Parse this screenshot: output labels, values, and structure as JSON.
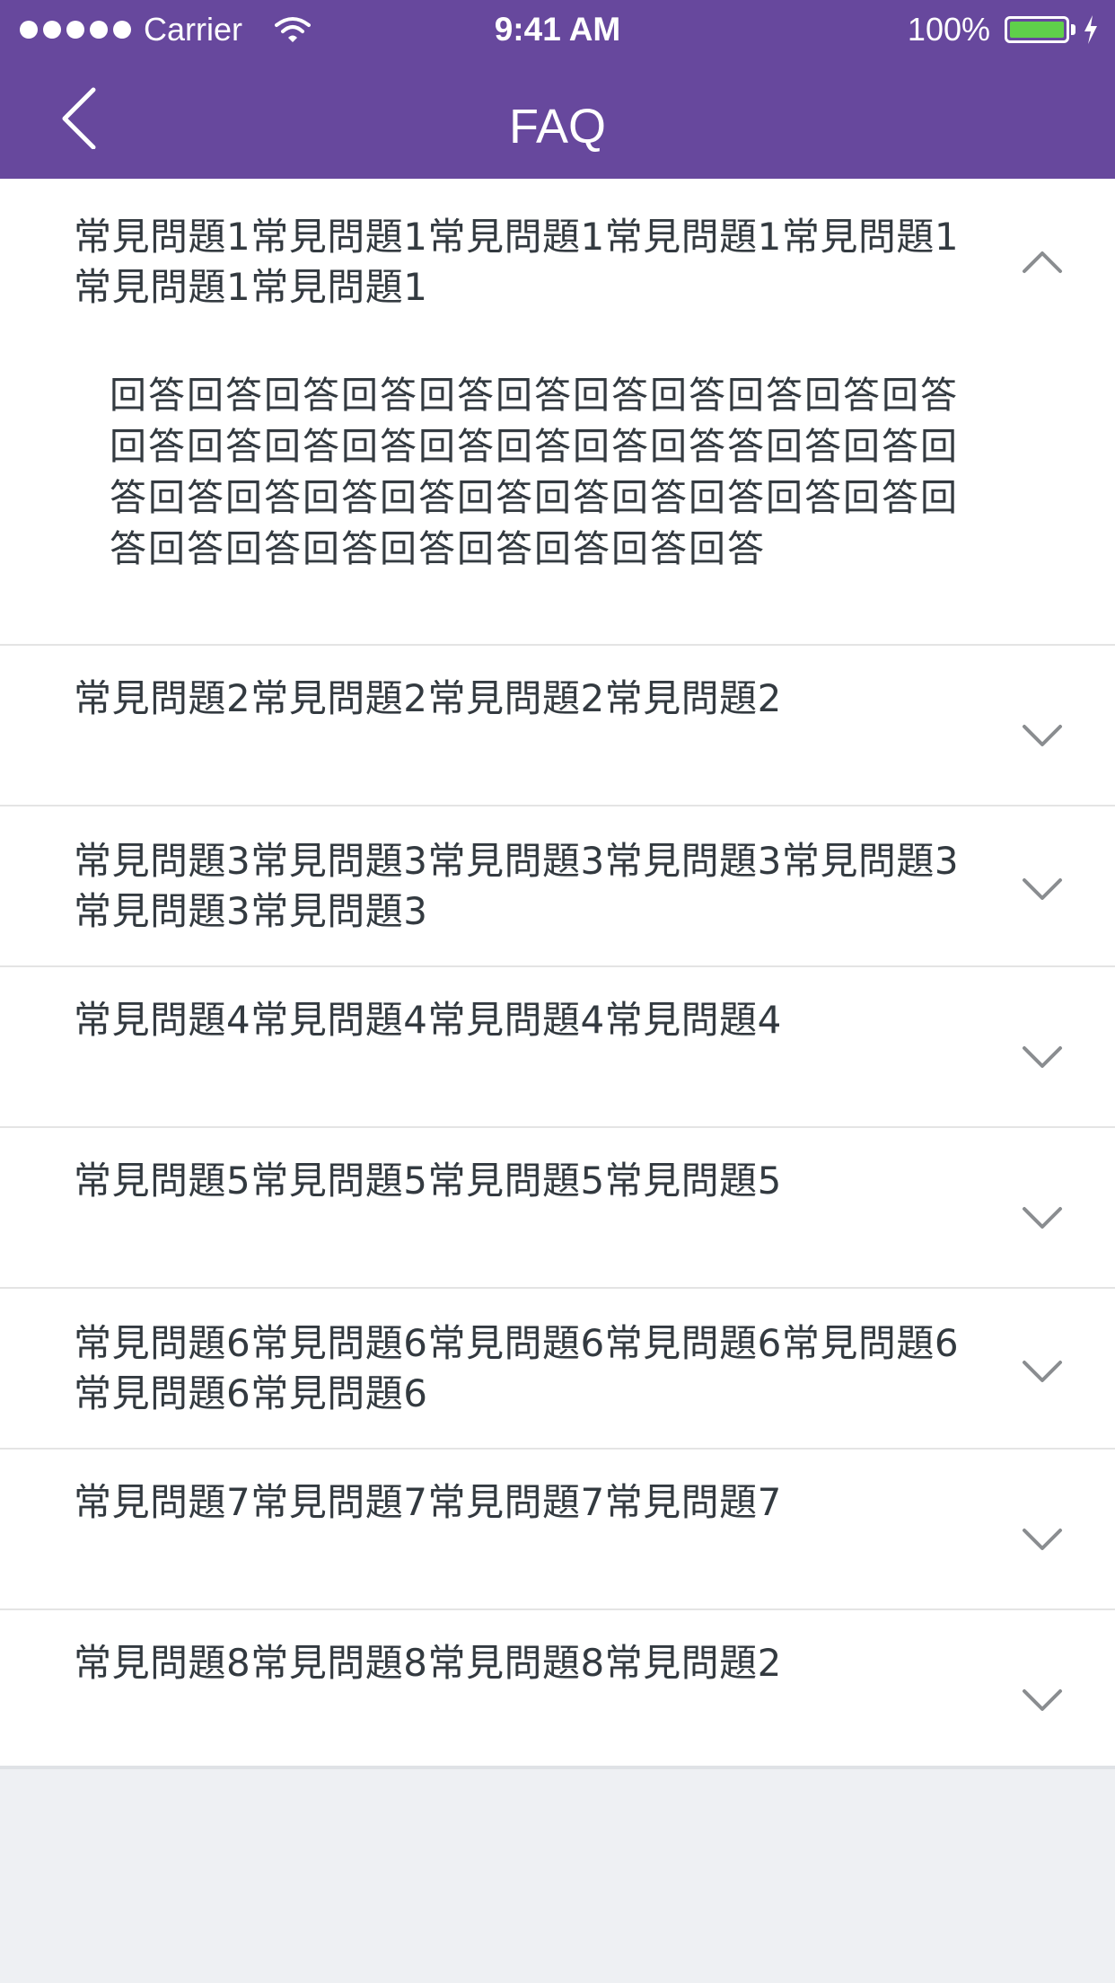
{
  "status_bar": {
    "carrier": "Carrier",
    "time": "9:41 AM",
    "battery": "100%",
    "battery_level": 1.0,
    "signal_dots": 5
  },
  "nav": {
    "title": "FAQ",
    "back_icon": "chevron-left-icon"
  },
  "faq": [
    {
      "question": "常見問題1常見問題1常見問題1常見問題1常見問題1常見問題1常見問題1",
      "answer": "回答回答回答回答回答回答回答回答回答回答回答回答回答回答回答回答回答回答回答答回答回答回答回答回答回答回答回答回答回答回答回答回答回答回答回答回答回答回答回答回答回答",
      "expanded": true
    },
    {
      "question": "常見問題2常見問題2常見問題2常見問題2",
      "expanded": false
    },
    {
      "question": "常見問題3常見問題3常見問題3常見問題3常見問題3常見問題3常見問題3",
      "expanded": false
    },
    {
      "question": "常見問題4常見問題4常見問題4常見問題4",
      "expanded": false
    },
    {
      "question": "常見問題5常見問題5常見問題5常見問題5",
      "expanded": false
    },
    {
      "question": "常見問題6常見問題6常見問題6常見問題6常見問題6常見問題6常見問題6",
      "expanded": false
    },
    {
      "question": "常見問題7常見問題7常見問題7常見問題7",
      "expanded": false
    },
    {
      "question": "常見問題8常見問題8常見問題8常見問題2",
      "expanded": false
    }
  ],
  "colors": {
    "header": "#67489d",
    "text": "#333a40",
    "chevron": "#8a8d90",
    "divider": "#e4e4e4",
    "page_bg": "#eef0f3",
    "battery_fill": "#5fd04a"
  }
}
